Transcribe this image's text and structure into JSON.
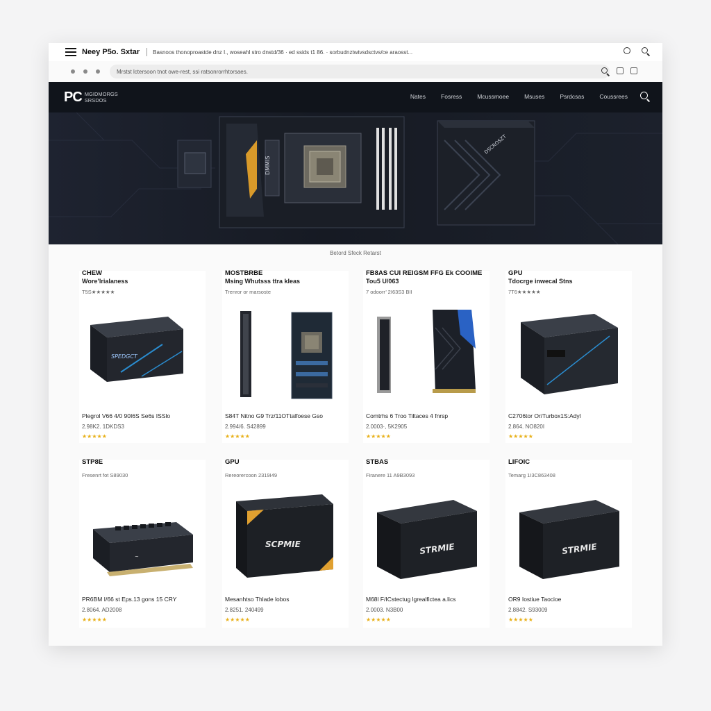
{
  "window": {
    "app_title": "Neey P5o. Sxtar",
    "title_tab": "Basnoos thonoproastde dnz I., woseahl stro dnstd/36 · ed ssids t1 86. · sorbudnztwtvsdsctvs/ce araosst..."
  },
  "address_bar": {
    "url": "Mrstst lctersoon tnot owe-rest, ssi ratsonrorrhtorsaes."
  },
  "site": {
    "logo_main": "PC",
    "logo_sub_1": "MGIDMORGS",
    "logo_sub_2": "SRSDOS",
    "nav": [
      "Nates",
      "Fosress",
      "Mcussmoee",
      "Msuses",
      "Psrdcsas",
      "Coussrees"
    ]
  },
  "hero": {
    "caption": "Betord Sfeck Retarst"
  },
  "products": [
    {
      "category": "CHEW",
      "subtitle": "Wore’lrialaness",
      "meta": "T5S★★★★★",
      "name": "Plegrol V66 4/0 90I6S Se6s ISSlo",
      "price": "2.98K2. 1DKDS3",
      "stars": "★★★★★"
    },
    {
      "category": "MOSTBRBE",
      "subtitle": "Msing Whutsss ttra kleas",
      "meta": "Trenror or marsoste",
      "name": "S84T Nitno G9 Trz/11OTtalfoese Gso",
      "price": "2.994/6. S42899",
      "stars": "★★★★★"
    },
    {
      "category": "FB8AS CUI REIGSM FFG Ek COOIME",
      "subtitle": "Tou5 U/063",
      "meta": "7 odoorr’ 2I63S3 BII",
      "name": "Comtrhs 6 Troo Tiltaces 4 fnrsp",
      "price": "2.0003·, 5K2905",
      "stars": "★★★★★"
    },
    {
      "category": "GPU",
      "subtitle": "Tdocrge inwecal Stns",
      "meta": "7T6★★★★★",
      "name": "C2706tor Or/Turbox1S:Adyl",
      "price": "2.864. NO820I",
      "stars": "★★★★★"
    },
    {
      "category": "STP8E",
      "subtitle": "",
      "meta": "Fresenrt fot S89030",
      "name": "PR6BM I/66 st Eps.13 gons 15 CRY",
      "price": "2.8064. AD2008",
      "stars": "★★★★★"
    },
    {
      "category": "GPU",
      "subtitle": "",
      "meta": "Rereorercoon 2319I49",
      "name": "Mesanhtso Thlade lobos",
      "price": "2.8251. 240499",
      "stars": "★★★★★"
    },
    {
      "category": "STBAS",
      "subtitle": "",
      "meta": "Firanere 11 A9B3093",
      "name": "M68l F/ICstectug lgrealfictea a.lics",
      "price": "2.0003. N3B00",
      "stars": "★★★★★"
    },
    {
      "category": "LIFOIC",
      "subtitle": "",
      "meta": "Temarg 1I3C863408",
      "name": "OR9 Iostiue Taocioe",
      "price": "2.8842. S93009",
      "stars": "★★★★★"
    }
  ],
  "product_images": {
    "case_label": "SPEDGCT",
    "box_label": "SCPMIE",
    "psu_label_1": "STRMIE",
    "psu_label_2": "STRMIE",
    "hero_case_label": "DSCROSZT",
    "hero_mobo_label": "DMMIS"
  }
}
